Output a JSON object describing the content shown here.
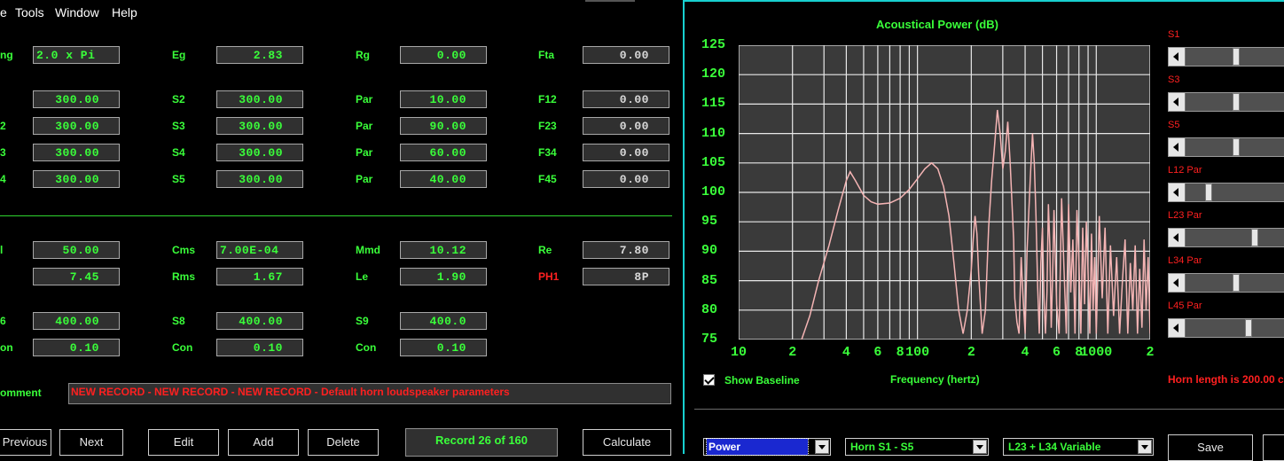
{
  "menu": [
    "e",
    "Tools",
    "Window",
    "Help"
  ],
  "form": {
    "rows1": [
      {
        "l1": "ng",
        "v1": "2.0 x Pi",
        "l2": "Eg",
        "v2": "2.83",
        "l3": "Rg",
        "v3": "0.00",
        "l4": "Fta",
        "v4": "0.00",
        "y": 52
      },
      {
        "l1": "",
        "v1": "300.00",
        "l2": "S2",
        "v2": "300.00",
        "l3": "Par",
        "v3": "10.00",
        "l4": "F12",
        "v4": "0.00",
        "y": 102
      },
      {
        "l1": "2",
        "v1": "300.00",
        "l2": "S3",
        "v2": "300.00",
        "l3": "Par",
        "v3": "90.00",
        "l4": "F23",
        "v4": "0.00",
        "y": 132
      },
      {
        "l1": "3",
        "v1": "300.00",
        "l2": "S4",
        "v2": "300.00",
        "l3": "Par",
        "v3": "60.00",
        "l4": "F34",
        "v4": "0.00",
        "y": 162
      },
      {
        "l1": "4",
        "v1": "300.00",
        "l2": "S5",
        "v2": "300.00",
        "l3": "Par",
        "v3": "40.00",
        "l4": "F45",
        "v4": "0.00",
        "y": 192
      }
    ],
    "rows2": [
      {
        "l1": "l",
        "v1": "50.00",
        "l2": "Cms",
        "v2": "7.00E-04",
        "l3": "Mmd",
        "v3": "10.12",
        "l4": "Re",
        "v4": "7.80"
      },
      {
        "l1": "",
        "v1": "7.45",
        "l2": "Rms",
        "v2": "1.67",
        "l3": "Le",
        "v3": "1.90",
        "l4": "PH1",
        "v4": "8P"
      },
      {
        "l1": "6",
        "v1": "400.00",
        "l2": "S8",
        "v2": "400.00",
        "l3": "S9",
        "v3": "400.0"
      },
      {
        "l1": "on",
        "v1": "0.10",
        "l2": "Con",
        "v2": "0.10",
        "l3": "Con",
        "v3": "0.10"
      }
    ],
    "comment_label": "omment",
    "comment": "NEW RECORD - NEW RECORD - NEW RECORD - Default horn loudspeaker parameters"
  },
  "buttons": {
    "previous": "Previous",
    "next": "Next",
    "edit": "Edit",
    "add": "Add",
    "delete": "Delete",
    "record": "Record 26 of 160",
    "calculate": "Calculate"
  },
  "chart_data": {
    "type": "line",
    "title": "Acoustical Power (dB)",
    "xlabel": "Frequency (hertz)",
    "ylabel": "",
    "x_scale": "log",
    "xlim": [
      10,
      2000
    ],
    "ylim": [
      75,
      125
    ],
    "yticks": [
      "125",
      "120",
      "115",
      "110",
      "105",
      "100",
      "95",
      "90",
      "85",
      "80",
      "75"
    ],
    "xticks": [
      "10",
      "2",
      "4",
      "6",
      "8",
      "100",
      "2",
      "4",
      "6",
      "8",
      "1000",
      "2"
    ],
    "grid": true,
    "series_color": "#f4b4b4",
    "x": [
      22.5,
      25,
      28,
      32,
      36,
      40,
      42,
      45,
      50,
      55,
      60,
      70,
      80,
      90,
      100,
      110,
      120,
      130,
      140,
      150,
      160,
      170,
      180,
      190,
      200,
      205,
      210,
      215,
      220,
      230,
      240,
      250,
      260,
      270,
      280,
      290,
      300,
      310,
      320,
      330,
      345,
      350,
      360,
      370,
      380,
      390,
      400,
      410,
      420,
      430,
      440,
      450,
      460,
      470,
      480,
      490,
      500,
      510,
      520,
      530,
      540,
      550,
      560,
      570,
      580,
      600,
      620,
      640,
      660,
      680,
      700,
      720,
      740,
      760,
      780,
      800,
      820,
      840,
      860,
      880,
      900,
      920,
      940,
      960,
      980,
      1000,
      1040,
      1080,
      1120,
      1160,
      1200,
      1250,
      1300,
      1350,
      1400,
      1450,
      1500,
      1550,
      1600,
      1650,
      1700,
      1750,
      1800,
      1850,
      1900,
      1950,
      2000
    ],
    "values": [
      75,
      79,
      85,
      91,
      97,
      102,
      103.5,
      102,
      99.5,
      98.4,
      98,
      98.2,
      99,
      100.5,
      102.3,
      104,
      105,
      104,
      101,
      96,
      88,
      80,
      76,
      80,
      87,
      92,
      96,
      93,
      86,
      76,
      80,
      94,
      102,
      108,
      114,
      110,
      104,
      107,
      112,
      105,
      92,
      82,
      78,
      76,
      89,
      82,
      76,
      90,
      97,
      104,
      110,
      105,
      96,
      84,
      76,
      88,
      94,
      82,
      76,
      83,
      98,
      91,
      77,
      86,
      97,
      81,
      76,
      99,
      87,
      76,
      98,
      83,
      92,
      76,
      97,
      88,
      76,
      94,
      81,
      95,
      86,
      76,
      93,
      80,
      89,
      76,
      96,
      82,
      94,
      76,
      91,
      79,
      89,
      76,
      85,
      92,
      76,
      88,
      80,
      91,
      76,
      87,
      77,
      92,
      80,
      89,
      76
    ]
  },
  "show_baseline": "Show Baseline",
  "sliders": [
    {
      "label": "S1",
      "level": 0.47
    },
    {
      "label": "S3",
      "level": 0.47
    },
    {
      "label": "S5",
      "level": 0.47
    },
    {
      "label": "L12 Par",
      "level": 0.2
    },
    {
      "label": "L23 Par",
      "level": 0.66
    },
    {
      "label": "L34 Par",
      "level": 0.47
    },
    {
      "label": "L45 Par",
      "level": 0.6
    }
  ],
  "horn_length": "Horn length is 200.00 c",
  "combos": {
    "mode": "Power",
    "range": "Horn S1 - S5",
    "variable": "L23 + L34 Variable"
  },
  "save": "Save"
}
